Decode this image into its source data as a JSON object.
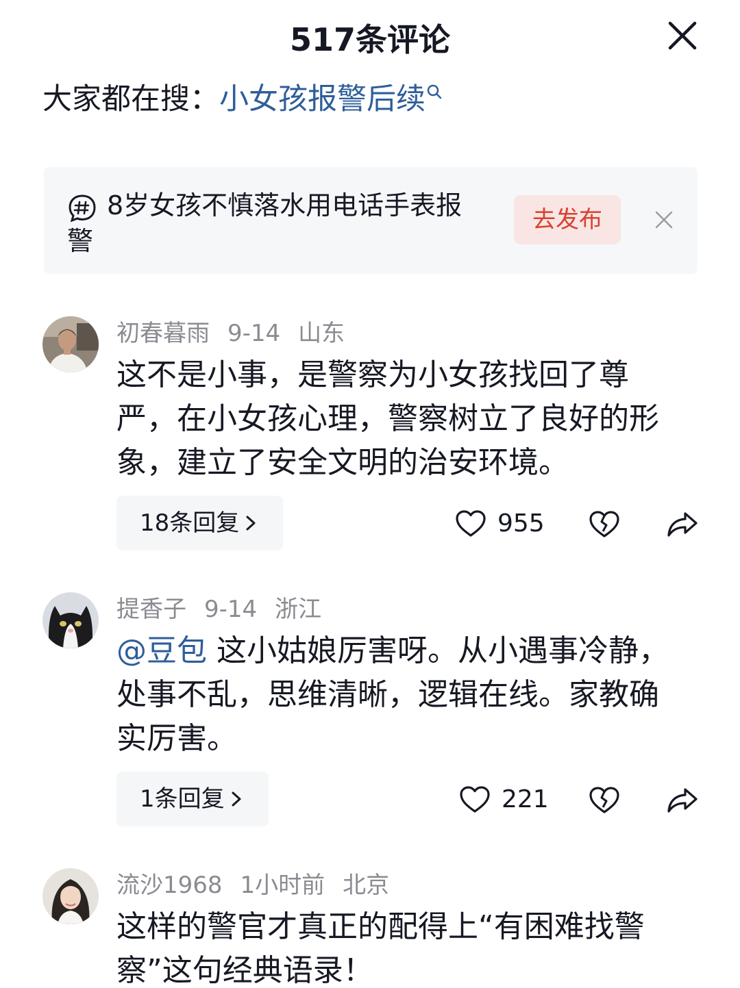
{
  "header": {
    "title": "517条评论"
  },
  "hot_search": {
    "label": "大家都在搜：",
    "query": "小女孩报警后续"
  },
  "topic_card": {
    "text": "8岁女孩不慎落水用电话手表报警",
    "publish_label": "去发布"
  },
  "comments": [
    {
      "username": "初春暮雨",
      "date": "9-14",
      "location": "山东",
      "mention": "",
      "text": "这不是小事，是警察为小女孩找回了尊严，在小女孩心理，警察树立了良好的形象，建立了安全文明的治安环境。",
      "replies_label": "18条回复",
      "likes": "955"
    },
    {
      "username": "提香子",
      "date": "9-14",
      "location": "浙江",
      "mention": "@豆包",
      "text": " 这小姑娘厉害呀。从小遇事冷静，处事不乱，思维清晰，逻辑在线。家教确实厉害。",
      "replies_label": "1条回复",
      "likes": "221"
    },
    {
      "username": "流沙1968",
      "date": "1小时前",
      "location": "北京",
      "mention": "",
      "text": "这样的警官才真正的配得上“有困难找警察”这句经典语录！",
      "replies_label": "",
      "likes": ""
    }
  ],
  "colors": {
    "link": "#2f5e9a",
    "publish_text": "#d8412f",
    "publish_bg": "#f8e5e4",
    "meta_gray": "#8a8b91",
    "pill_bg": "#f5f6f8"
  },
  "icons": [
    "close-icon",
    "search-icon",
    "topic-hashtag-icon",
    "heart-icon",
    "broken-heart-icon",
    "share-icon",
    "chevron-right-icon"
  ]
}
